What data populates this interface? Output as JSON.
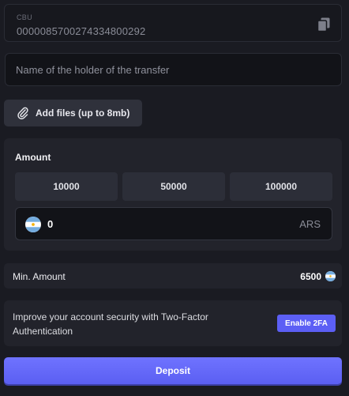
{
  "cbu": {
    "label": "CBU",
    "value": "0000085700274334800292",
    "copy_icon": "copy-icon"
  },
  "holder": {
    "placeholder": "Name of the holder of the transfer",
    "value": ""
  },
  "attach": {
    "label": "Add files (up to 8mb)",
    "icon": "paperclip-icon"
  },
  "amount": {
    "title": "Amount",
    "presets": [
      "10000",
      "50000",
      "100000"
    ],
    "value": "0",
    "currency": "ARS",
    "flag_icon": "argentina-flag-icon"
  },
  "min_amount": {
    "label": "Min. Amount",
    "value": "6500"
  },
  "security": {
    "message": "Improve your account security with Two-Factor Authentication",
    "button_label": "Enable 2FA"
  },
  "deposit": {
    "label": "Deposit"
  },
  "colors": {
    "background": "#1a1b22",
    "panel": "#22232b",
    "accent": "#5c5ff5",
    "flag_blue": "#74acdf",
    "flag_sun": "#f6b40e"
  }
}
